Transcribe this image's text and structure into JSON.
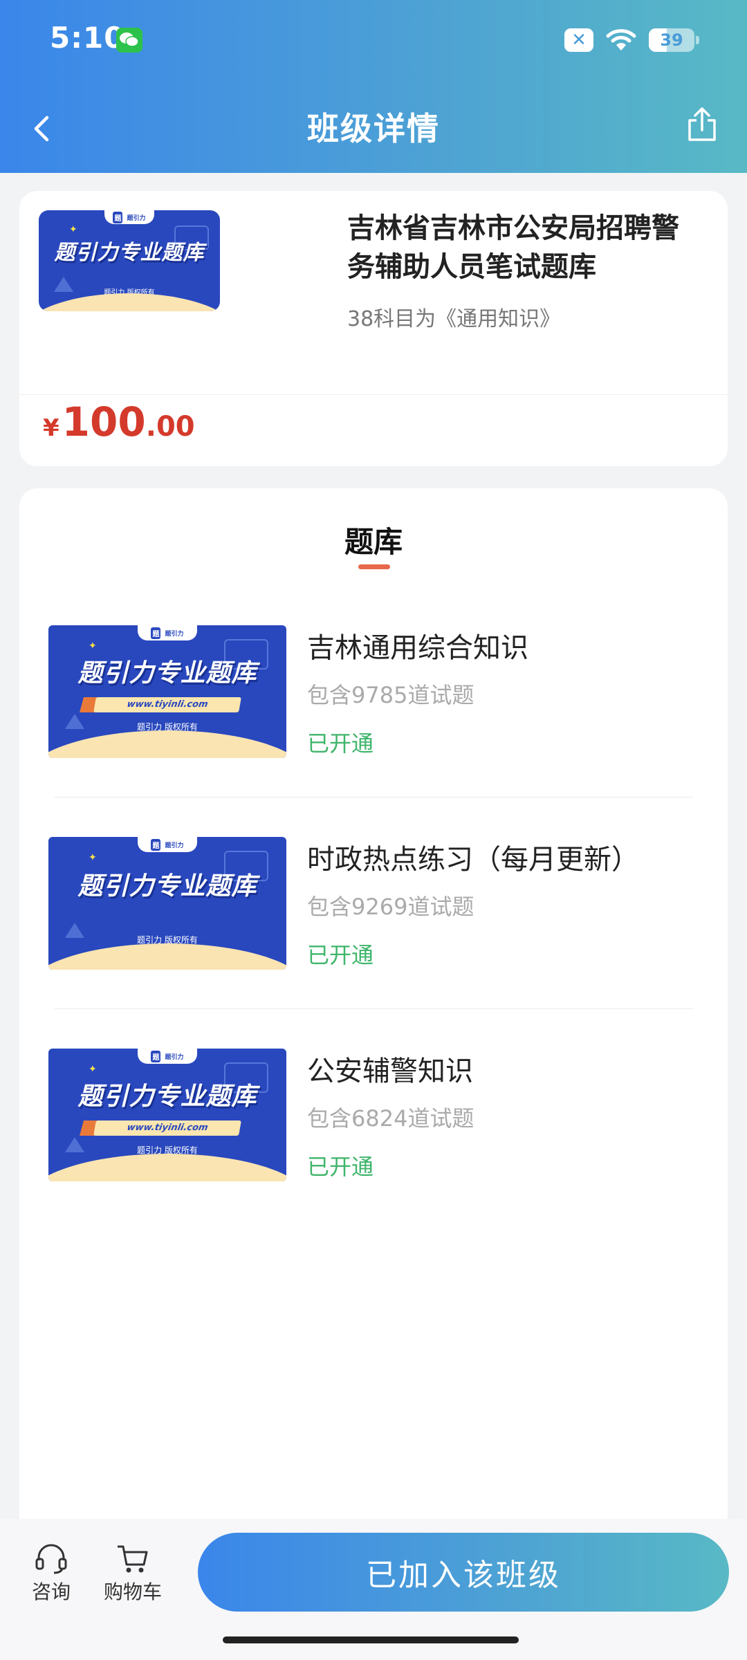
{
  "status_bar": {
    "time": "5:10",
    "battery": "39"
  },
  "header": {
    "title": "班级详情"
  },
  "class_info": {
    "banner": {
      "tab_logo": "题",
      "tab_text": "题引力",
      "title": "题引力专业题库",
      "copyright": "题引力 版权所有"
    },
    "title": "吉林省吉林市公安局招聘警务辅助人员笔试题库",
    "subtitle": "38科目为《通用知识》",
    "price": {
      "currency": "¥",
      "integer": "100",
      "decimal": ".00"
    }
  },
  "question_bank": {
    "section_title": "题库",
    "items": [
      {
        "name": "吉林通用综合知识",
        "count": "包含9785道试题",
        "status": "已开通",
        "banner_title": "题引力专业题库",
        "banner_url": "www.tiyinli.com",
        "banner_copyright": "题引力 版权所有",
        "banner_tab": "题引力"
      },
      {
        "name": "时政热点练习（每月更新）",
        "count": "包含9269道试题",
        "status": "已开通",
        "banner_title": "题引力专业题库",
        "banner_url": "",
        "banner_copyright": "题引力 版权所有",
        "banner_tab": "题引力"
      },
      {
        "name": "公安辅警知识",
        "count": "包含6824道试题",
        "status": "已开通",
        "banner_title": "题引力专业题库",
        "banner_url": "www.tiyinli.com",
        "banner_copyright": "题引力 版权所有",
        "banner_tab": "题引力"
      }
    ]
  },
  "bottom_bar": {
    "consult_label": "咨询",
    "cart_label": "购物车",
    "join_label": "已加入该班级"
  },
  "colors": {
    "brand_gradient_start": "#3a86ea",
    "brand_gradient_end": "#58b9c5",
    "price_red": "#d43a2b",
    "status_green": "#3fb56b",
    "banner_blue": "#2948be"
  }
}
